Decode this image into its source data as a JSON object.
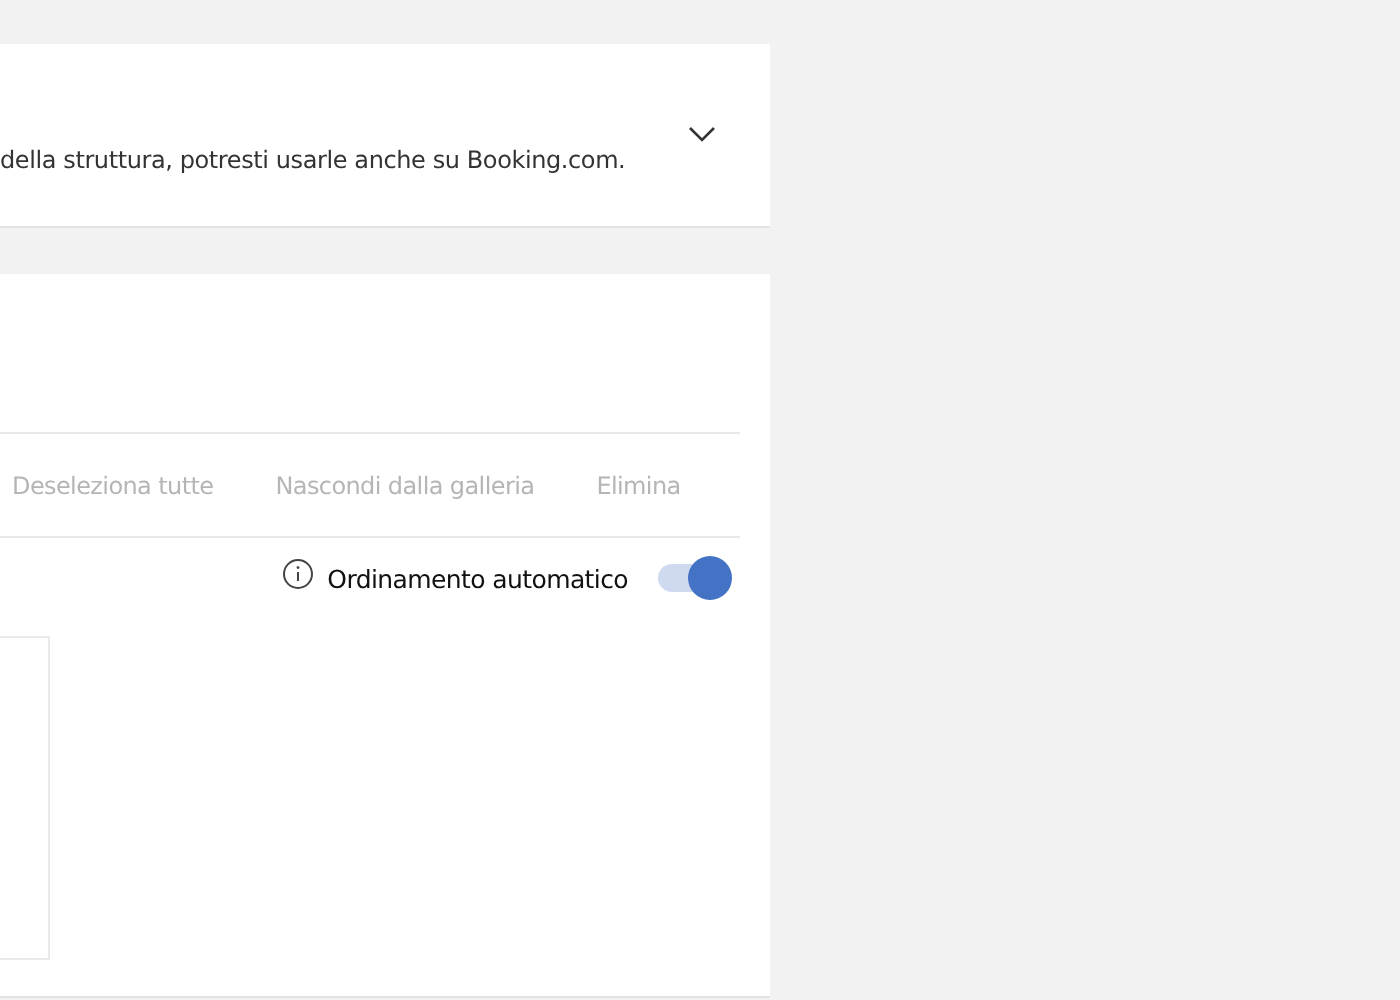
{
  "info_panel": {
    "text": "della struttura, potresti usarle anche su Booking.com.",
    "expanded": false
  },
  "actions": [
    {
      "label": "Deseleziona tutte",
      "disabled": true
    },
    {
      "label": "Nascondi dalla galleria",
      "disabled": true
    },
    {
      "label": "Elimina",
      "disabled": true
    }
  ],
  "auto_sort": {
    "label": "Ordinamento automatico",
    "on": true
  }
}
